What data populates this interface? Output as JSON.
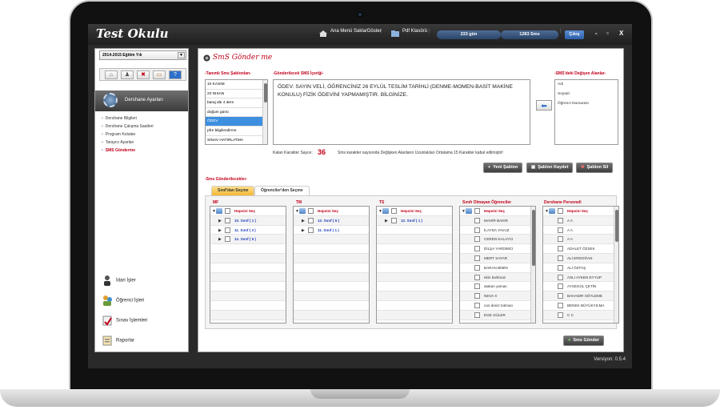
{
  "app": {
    "title": "Test Okulu",
    "version": "Versiyon: 0.5.4"
  },
  "topbar": {
    "menu_toggle": "Ana Menü Sakla/Göster",
    "pdf_folder": "Pdf Klasörü",
    "days_pill": "233 gün",
    "sms_pill": "1283 Sms",
    "exit": "Çıkış",
    "min": "-",
    "max": "▫",
    "close": "X"
  },
  "sidebar": {
    "year": "2014-2015 Eğitim Yılı",
    "year_arrow": "▼",
    "icons": [
      "home-icon",
      "user-icon",
      "close-icon",
      "calendar-icon",
      "info-icon"
    ],
    "icon_glyphs": [
      "⌂",
      "♟",
      "✖",
      "▭",
      "?"
    ],
    "section_title": "Dershane Ayarları",
    "items": [
      {
        "label": "Dershane Bilgileri"
      },
      {
        "label": "Dershane Çalışma Saatleri"
      },
      {
        "label": "Program Kotaları"
      },
      {
        "label": "Tarayıcı Ayarları"
      },
      {
        "label": "SMS Gönderme"
      }
    ],
    "modules": [
      {
        "label": "İdari İşler"
      },
      {
        "label": "Öğrenci İşleri"
      },
      {
        "label": "Sınav İşlemleri"
      },
      {
        "label": "Raporlar"
      }
    ]
  },
  "main": {
    "page_title": "SmS Gönder me",
    "templates_label": "-Tanımlı Sms Şablonları-",
    "templates": [
      "10 KASIM",
      "23 NISAN",
      "baraj altı 4 ders",
      "doğum günü",
      "ÖDEV",
      "pfre bilgilendirme",
      "SINAV HATIRLATMA"
    ],
    "content_label": "-Gönderilecek SMS İçeriği-",
    "content": "ÖDEV: SAYIN VELİ, ÖĞRENCİNİZ 26 EYLÜL TESLİM TARİHLİ (DENME-MOMEN-BASİT MAKİNE KONULU) FİZİK ÖDEVİNİ YAPMAMIŞTIR. BİLGİNİZE.",
    "fields_label": "-SMS'deki Değişen Alanlar-",
    "fields": [
      "Adı",
      "Soyadı",
      "Öğrenci Numarası"
    ],
    "arrow": "⬅",
    "remaining_label": "Kalan Karakter Sayısı:",
    "remaining_value": "36",
    "note": "Sms karakter sayısında Değişken Alanların Uzunlukları Ortalama 15 Karakter kabul edilmiştir!",
    "buttons": {
      "new": "Yeni Şablon",
      "save": "Şablon Kaydet",
      "delete": "Şablon Sil"
    },
    "recipients_label": "-Sms Gönderilecekler-",
    "tabs": [
      "Sınıf'dan Seçme",
      "Öğrenciler'den Seçme"
    ],
    "select_all": "Hepsini Seç",
    "columns": [
      {
        "title": "MF",
        "rows": [
          "10. Sınıf ( 1 )",
          "11. Sınıf ( 3 )",
          "12. Sınıf ( 5 )"
        ]
      },
      {
        "title": "TM",
        "rows": [
          "12. Sınıf ( 5 )",
          "11. Sınıf ( 1 )"
        ]
      },
      {
        "title": "TS",
        "rows": [
          "12. Sınıf ( 1 )"
        ]
      },
      {
        "title": "Sınıfı Olmayan Öğrenciler",
        "rows": [
          "MAHİR BAKIR",
          "İLAYDA YAVUZ",
          "CEREN KALAYCI",
          "DİLŞA YARDIMCI",
          "MERT SAYAR",
          "BARAN BİMİN",
          "ekin korkmaz",
          "atakan yaman",
          "NEVA X",
          "can deniz tokman",
          "EGE GÜLER"
        ]
      },
      {
        "title": "Dershane Personeli",
        "rows": [
          "A A",
          "A A",
          "A A",
          "ADALET ÖZSEK",
          "ALİ ERDOĞAN",
          "ALİ ÖZTAŞ",
          "ASLI AYKEN EYYUP",
          "AYSEGÜL ÇETİN",
          "BAHADIR SÖYLEME",
          "BENEK BÜYÜKYILMA",
          "C C"
        ]
      }
    ],
    "send_button": "Sms Gönder"
  },
  "colors": {
    "accent_red": "#c0001a",
    "link_blue": "#2340b9",
    "selected_blue": "#3d8fe0",
    "tab_active": "#f2b736"
  }
}
